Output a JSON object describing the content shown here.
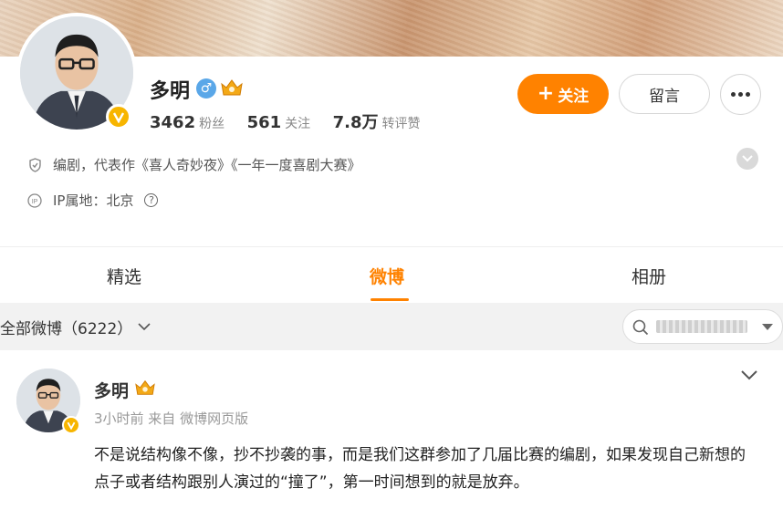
{
  "profile": {
    "name": "多明",
    "gender_symbol": "♂",
    "stats": [
      {
        "value": "3462",
        "label": "粉丝"
      },
      {
        "value": "561",
        "label": "关注"
      },
      {
        "value": "7.8万",
        "label": "转评赞"
      }
    ],
    "bio": "编剧，代表作《喜人奇妙夜》《一年一度喜剧大赛》",
    "ip_location": "IP属地：北京",
    "ip_help": "?"
  },
  "actions": {
    "follow_label": "关注",
    "follow_plus": "+",
    "message_label": "留言"
  },
  "tabs": [
    {
      "label": "精选",
      "active": false
    },
    {
      "label": "微博",
      "active": true
    },
    {
      "label": "相册",
      "active": false
    }
  ],
  "filter": {
    "label": "全部微博（6222）"
  },
  "post": {
    "author": "多明",
    "meta": "3小时前  来自 微博网页版",
    "text": "不是说结构像不像，抄不抄袭的事，而是我们这群参加了几届比赛的编剧，如果发现自己新想的点子或者结构跟别人演过的“撞了”，第一时间想到的就是放弃。"
  },
  "colors": {
    "accent": "#ff8200",
    "verified_gold": "#f7b500",
    "gender_blue": "#5aa7e8"
  },
  "icons": [
    "verified-icon",
    "male-icon",
    "vip-crown-icon",
    "shield-icon",
    "ip-icon",
    "help-icon",
    "chevron-down-icon",
    "search-icon",
    "more-icon"
  ]
}
